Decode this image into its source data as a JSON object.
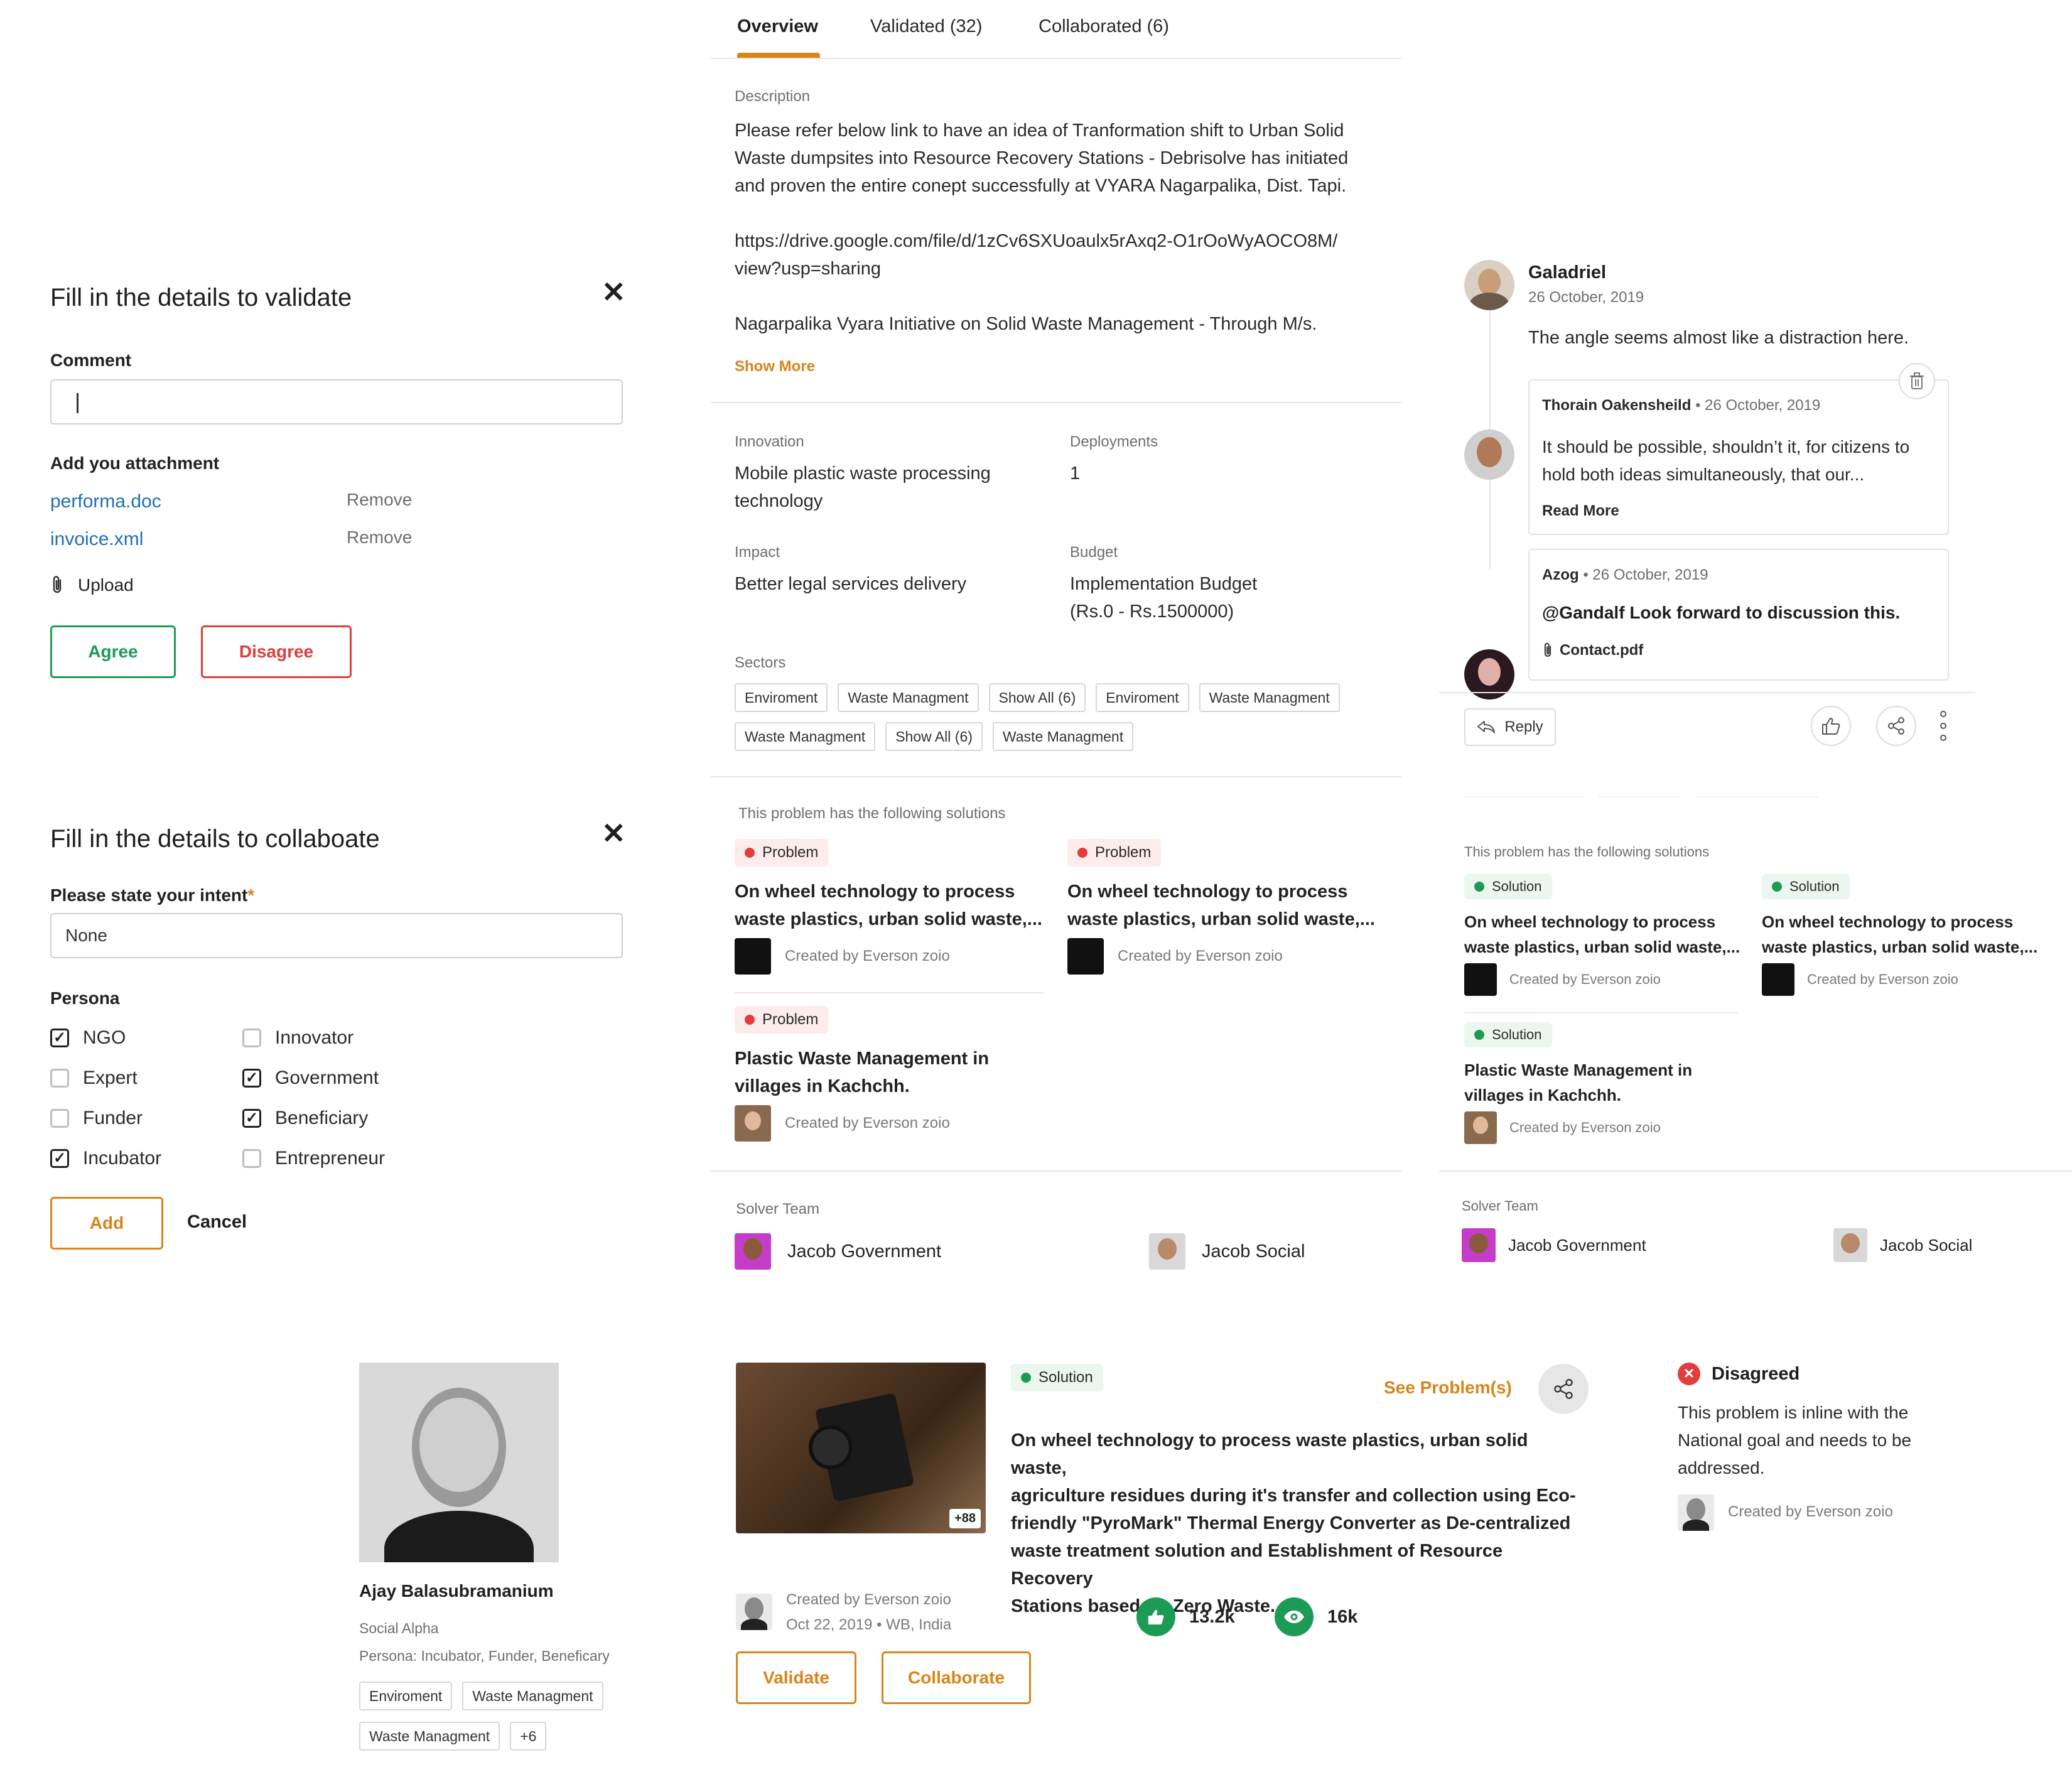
{
  "validate_panel": {
    "title": "Fill in the details to validate",
    "comment_label": "Comment",
    "comment_value": "",
    "attachment_label": "Add you attachment",
    "attachments": [
      {
        "name": "performa.doc",
        "remove": "Remove"
      },
      {
        "name": "invoice.xml",
        "remove": "Remove"
      }
    ],
    "upload_label": "Upload",
    "agree_label": "Agree",
    "disagree_label": "Disagree"
  },
  "collaborate_panel": {
    "title": "Fill in the details to collaboate",
    "intent_label": "Please state your intent",
    "required_mark": "*",
    "intent_value": "None",
    "persona_label": "Persona",
    "personas": [
      {
        "label": "NGO",
        "checked": true
      },
      {
        "label": "Innovator",
        "checked": false
      },
      {
        "label": "Expert",
        "checked": false
      },
      {
        "label": "Government",
        "checked": true
      },
      {
        "label": "Funder",
        "checked": false
      },
      {
        "label": "Beneficiary",
        "checked": true
      },
      {
        "label": "Incubator",
        "checked": true
      },
      {
        "label": "Entrepreneur",
        "checked": false
      }
    ],
    "add_label": "Add",
    "cancel_label": "Cancel"
  },
  "tabs": {
    "overview": "Overview",
    "validated": "Validated (32)",
    "collaborated": "Collaborated (6)"
  },
  "overview": {
    "description_label": "Description",
    "description_p1": "Please refer below link to have an idea of Tranformation shift to Urban Solid Waste dumpsites into Resource Recovery Stations - Debrisolve has initiated and proven the entire conept successfully at VYARA Nagarpalika, Dist. Tapi.",
    "description_link_line1": "https://drive.google.com/file/d/1zCv6SXUoaulx5rAxq2-O1rOoWyAOCO8M/",
    "description_link_line2": "view?usp=sharing",
    "description_p3": "Nagarpalika Vyara Initiative on Solid Waste Management -  Through M/s.",
    "show_more": "Show More",
    "innovation_label": "Innovation",
    "innovation_line1": "Mobile plastic waste processing",
    "innovation_line2": "technology",
    "deployments_label": "Deployments",
    "deployments_value": "1",
    "impact_label": "Impact",
    "impact_value": "Better legal services delivery",
    "budget_label": "Budget",
    "budget_line1": "Implementation Budget",
    "budget_line2": "(Rs.0 - Rs.1500000)",
    "sectors_label": "Sectors",
    "sectors_row1": [
      "Enviroment",
      "Waste Managment",
      "Show All (6)",
      "Enviroment",
      "Waste Managment"
    ],
    "sectors_row2": [
      "Waste Managment",
      "Show All (6)",
      "Waste Managment"
    ]
  },
  "problems_section": {
    "heading": "This problem has the following solutions",
    "badge": "Problem",
    "cards": [
      {
        "title_l1": "On wheel technology to process",
        "title_l2": "waste plastics, urban solid waste,...",
        "creator": "Created by Everson zoio"
      },
      {
        "title_l1": "On wheel technology to process",
        "title_l2": "waste plastics, urban solid waste,...",
        "creator": "Created by Everson zoio"
      },
      {
        "title_l1": "Plastic Waste Management in",
        "title_l2": "villages in Kachchh.",
        "creator": "Created by Everson zoio"
      }
    ]
  },
  "solver_team": {
    "label": "Solver Team",
    "members": [
      "Jacob Government",
      "Jacob Social"
    ]
  },
  "comments": {
    "main": {
      "author": "Galadriel",
      "date": "26 October, 2019",
      "text": "The angle seems almost like a distraction here."
    },
    "reply1": {
      "author": "Thorain Oakensheild",
      "sep": "•",
      "date": "26 October, 2019",
      "text_l1": "It should be possible, shouldn’t it, for citizens to",
      "text_l2": "hold both ideas simultaneously, that our...",
      "read_more": "Read More"
    },
    "reply2": {
      "author": "Azog",
      "sep": "•",
      "date": "26 October, 2019",
      "text": "@Gandalf Look forward to discussion this.",
      "attachment": "Contact.pdf"
    },
    "reply_button": "Reply"
  },
  "solutions_section": {
    "heading": "This problem has the following solutions",
    "badge": "Solution",
    "cards": [
      {
        "title_l1": "On wheel technology to process",
        "title_l2": "waste plastics, urban solid waste,...",
        "creator": "Created by Everson zoio"
      },
      {
        "title_l1": "On wheel technology to process",
        "title_l2": "waste plastics, urban solid waste,...",
        "creator": "Created by Everson zoio"
      },
      {
        "title_l1": "Plastic Waste Management in",
        "title_l2": "villages in Kachchh.",
        "creator": "Created by Everson zoio"
      }
    ]
  },
  "solver_team_right": {
    "label": "Solver Team",
    "members": [
      "Jacob Government",
      "Jacob Social"
    ]
  },
  "profile": {
    "name": "Ajay Balasubramanium",
    "org": "Social Alpha",
    "persona": "Persona: Incubator, Funder, Beneficary",
    "tags": [
      "Enviroment",
      "Waste Managment",
      "Waste Managment",
      "+6"
    ]
  },
  "solution_card": {
    "badge": "Solution",
    "see_problems": "See Problem(s)",
    "image_count": "+88",
    "title_lines": [
      "On wheel technology to process waste plastics, urban solid waste,",
      "agriculture residues during it's transfer and collection using Eco-",
      "friendly \"PyroMark\" Thermal Energy Converter as De-centralized",
      "waste treatment solution and Establishment of Resource Recovery",
      "Stations based on Zero Waste."
    ],
    "creator": "Created by Everson zoio",
    "meta": "Oct 22, 2019 • WB, India",
    "likes": "13.2k",
    "views": "16k",
    "validate_label": "Validate",
    "collaborate_label": "Collaborate"
  },
  "disagreed": {
    "title": "Disagreed",
    "text_lines": [
      "This problem is inline with the",
      "National goal and needs to be",
      "addressed."
    ],
    "creator": "Created by Everson zoio"
  },
  "colors": {
    "accent": "#d9841a",
    "green": "#1d9b55",
    "red": "#e23c3c",
    "link": "#1f6fb5"
  }
}
